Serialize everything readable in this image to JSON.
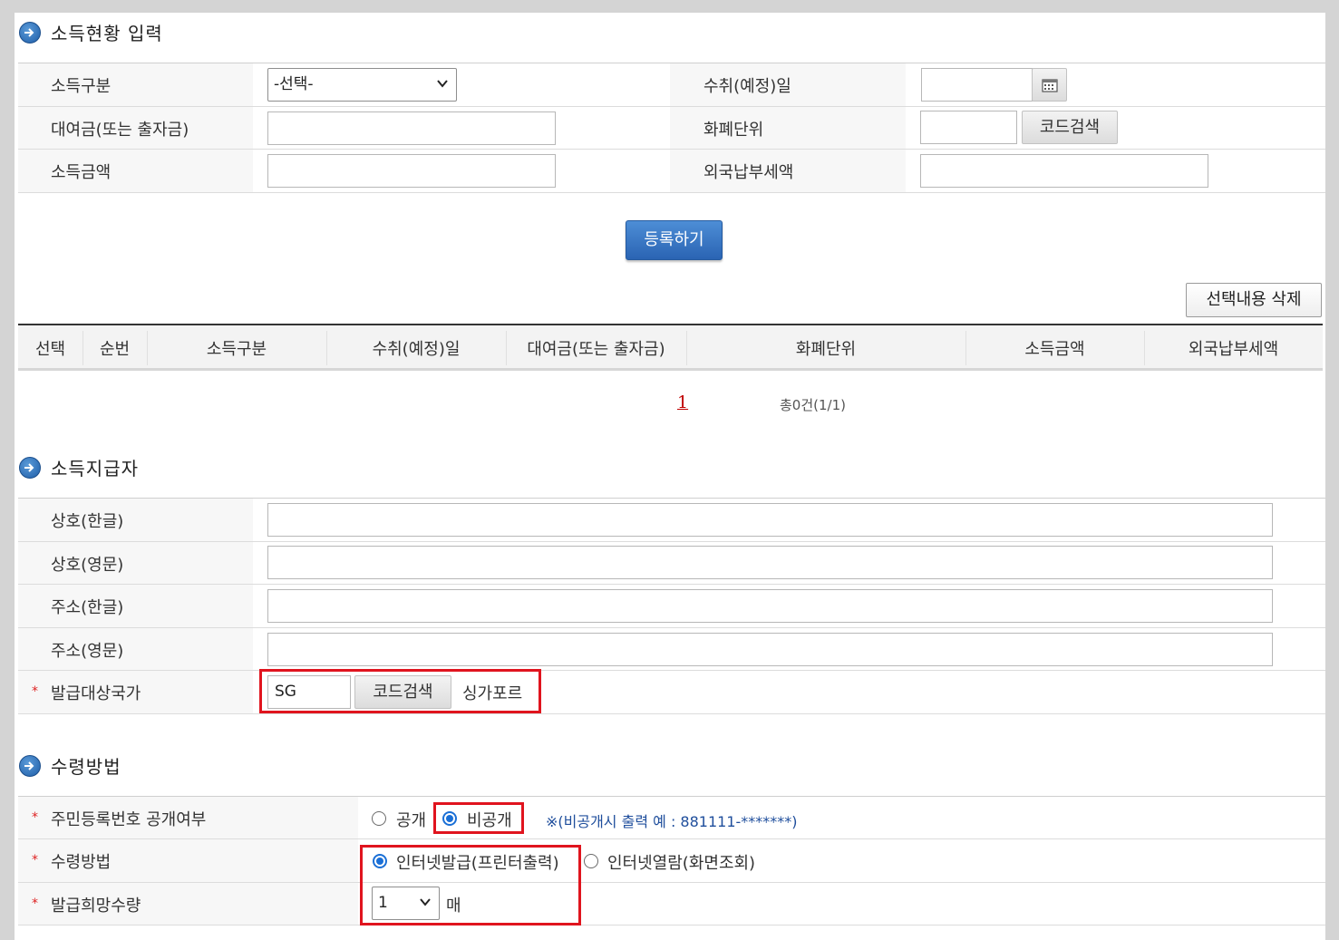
{
  "income_section": {
    "title": "소득현황 입력",
    "income_type_label": "소득구분",
    "income_type_select": "-선택-",
    "receipt_date_label": "수취(예정)일",
    "receipt_date_value": "",
    "loan_amount_label": "대여금(또는 출자금)",
    "loan_amount_value": "",
    "currency_label": "화폐단위",
    "currency_value": "",
    "currency_search_button": "코드검색",
    "income_amount_label": "소득금액",
    "income_amount_value": "",
    "foreign_tax_label": "외국납부세액",
    "foreign_tax_value": "",
    "register_button": "등록하기",
    "delete_selected_button": "선택내용 삭제"
  },
  "income_table": {
    "headers": [
      "선택",
      "순번",
      "소득구분",
      "수취(예정)일",
      "대여금(또는 출자금)",
      "화폐단위",
      "소득금액",
      "외국납부세액"
    ],
    "rows": []
  },
  "pagination": {
    "current_page": "1",
    "summary": "총0건(1/1)"
  },
  "payer_section": {
    "title": "소득지급자",
    "name_kor_label": "상호(한글)",
    "name_kor_value": "",
    "name_eng_label": "상호(영문)",
    "name_eng_value": "",
    "addr_kor_label": "주소(한글)",
    "addr_kor_value": "",
    "addr_eng_label": "주소(영문)",
    "addr_eng_value": "",
    "country_label": "발급대상국가",
    "country_code": "SG",
    "country_search_button": "코드검색",
    "country_name": "싱가포르"
  },
  "receipt_section": {
    "title": "수령방법",
    "rrn_disclosure_label": "주민등록번호 공개여부",
    "rrn_option_public": "공개",
    "rrn_option_private": "비공개",
    "rrn_selected": "비공개",
    "rrn_note": "※(비공개시 출력 예 : 881111-*******)",
    "method_label": "수령방법",
    "method_option_print": "인터넷발급(프린터출력)",
    "method_option_view": "인터넷열람(화면조회)",
    "method_selected": "인터넷발급(프린터출력)",
    "quantity_label": "발급희망수량",
    "quantity_value": "1",
    "quantity_unit": "매"
  },
  "required_mark": "*",
  "colors": {
    "highlight_red": "#e0141e",
    "primary_blue": "#2a64b3",
    "radio_blue": "#1a6fd6",
    "note_blue": "#1f4e9c",
    "link_red": "#c00000"
  }
}
